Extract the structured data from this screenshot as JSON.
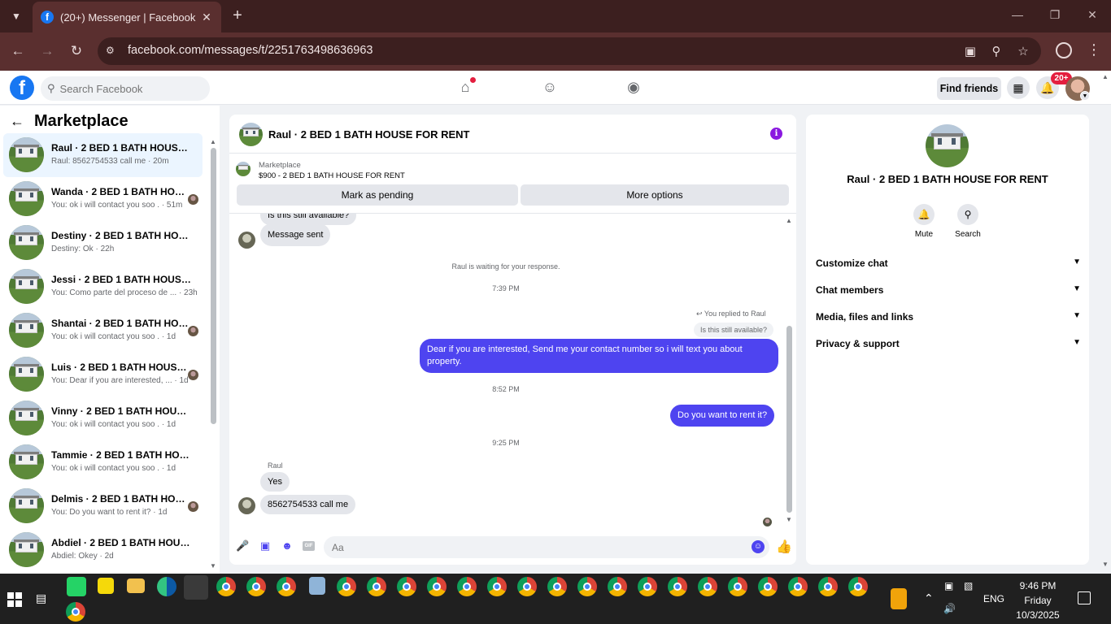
{
  "browser": {
    "tab_title": "(20+) Messenger | Facebook",
    "url": "facebook.com/messages/t/2251763498636963"
  },
  "fb": {
    "search_placeholder": "Search Facebook",
    "find_friends": "Find friends",
    "notifications_badge": "20+"
  },
  "left": {
    "title": "Marketplace",
    "conversations": [
      {
        "title": "Raul · 2 BED 1 BATH HOUSE FO...",
        "sub": "Raul: 8562754533 call me · 20m",
        "seen": false,
        "active": true
      },
      {
        "title": "Wanda · 2 BED 1 BATH HOUS...",
        "sub": "You: ok i will contact you soo . · 51m",
        "seen": true,
        "active": false
      },
      {
        "title": "Destiny · 2 BED 1 BATH HOUSE ...",
        "sub": "Destiny: Ok · 22h",
        "seen": false,
        "active": false
      },
      {
        "title": "Jessi · 2 BED 1 BATH HOUSE FO...",
        "sub": "You: Como parte del proceso de ... · 23h",
        "seen": false,
        "active": false
      },
      {
        "title": "Shantai · 2 BED 1 BATH HOUS...",
        "sub": "You: ok i will contact you soo . · 1d",
        "seen": true,
        "active": false
      },
      {
        "title": "Luis · 2 BED 1 BATH HOUSE F...",
        "sub": "You: Dear if you are interested, ... · 1d",
        "seen": true,
        "active": false
      },
      {
        "title": "Vinny · 2 BED 1 BATH HOUSE F...",
        "sub": "You: ok i will contact you soo . · 1d",
        "seen": false,
        "active": false
      },
      {
        "title": "Tammie · 2 BED 1 BATH HOUSE ...",
        "sub": "You: ok i will contact you soo . · 1d",
        "seen": false,
        "active": false
      },
      {
        "title": "Delmis · 2 BED 1 BATH HOUS...",
        "sub": "You: Do you want to rent it? · 1d",
        "seen": true,
        "active": false
      },
      {
        "title": "Abdiel · 2 BED 1 BATH HOUSE F...",
        "sub": "Abdiel: Okey · 2d",
        "seen": false,
        "active": false
      }
    ]
  },
  "chat": {
    "title": "Raul · 2 BED 1 BATH HOUSE FOR RENT",
    "marketplace_label": "Marketplace",
    "listing": "$900 - 2 BED 1 BATH HOUSE FOR RENT",
    "mark_pending": "Mark as pending",
    "more_options": "More options",
    "msg_partial": "Is this still available?",
    "msg_sent": "Message sent",
    "waiting": "Raul is waiting for your response.",
    "time1": "7:39 PM",
    "replied_label": "You replied to Raul",
    "quoted": "Is this still available?",
    "out1": "Dear if you are interested, Send me your contact number so i will text you about property.",
    "time2": "8:52 PM",
    "out2": "Do you want to rent it?",
    "time3": "9:25 PM",
    "sender": "Raul",
    "in_yes": "Yes",
    "in_phone": "8562754533 call me",
    "input_placeholder": "Aa"
  },
  "right": {
    "title": "Raul · 2 BED 1 BATH HOUSE FOR RENT",
    "mute": "Mute",
    "search": "Search",
    "sections": [
      "Customize chat",
      "Chat members",
      "Media, files and links",
      "Privacy & support"
    ]
  },
  "taskbar": {
    "lang": "ENG",
    "time": "9:46 PM",
    "day": "Friday",
    "date": "10/3/2025"
  },
  "colors": {
    "accent": "#4e44f0",
    "fb_blue": "#1877f2",
    "browser_dark": "#3c1f1f",
    "browser_mid": "#5a2f2f",
    "badge_red": "#e41e3f"
  }
}
